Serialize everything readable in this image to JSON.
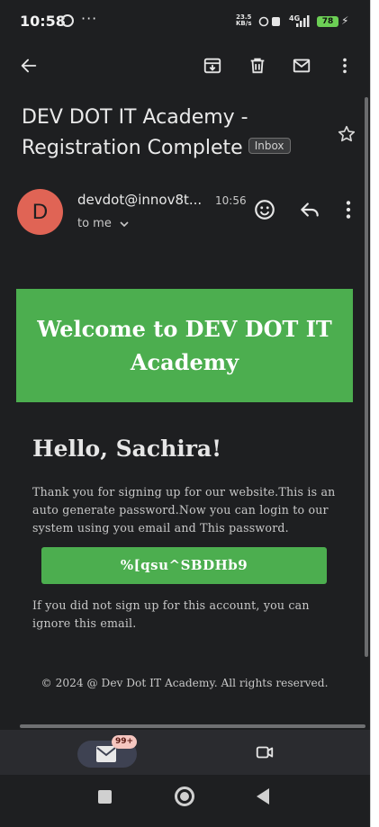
{
  "status_bar": {
    "time": "10:58",
    "dots": "···",
    "net_speed_value": "23.5",
    "net_speed_unit": "KB/s",
    "network": "4G",
    "battery": "78"
  },
  "email": {
    "subject": "DEV DOT IT Academy - Registration Complete",
    "label": "Inbox",
    "sender_initial": "D",
    "sender": "devdot@innov8t...",
    "time": "10:56",
    "recipient": "to me"
  },
  "body": {
    "banner": "Welcome to DEV DOT IT Academy",
    "greeting": "Hello, Sachira!",
    "intro": "Thank you for signing up for our website.This is an auto generate password.Now you can login to our system using you email and This password.",
    "password": "%[qsu^SBDHb9",
    "note": "If you did not sign up for this account, you can ignore this email.",
    "footer": "© 2024 @ Dev Dot IT Academy. All rights reserved."
  },
  "bottom_nav": {
    "mail_badge": "99+"
  },
  "icons": {
    "toolbar": [
      "back-arrow-icon",
      "archive-icon",
      "delete-icon",
      "mark-unread-icon",
      "more-vert-icon"
    ],
    "actions": [
      "emoji-icon",
      "reply-icon",
      "more-vert-icon"
    ]
  },
  "colors": {
    "background": "#1e1f21",
    "accent_green": "#4cae4f",
    "avatar": "#e06455"
  }
}
